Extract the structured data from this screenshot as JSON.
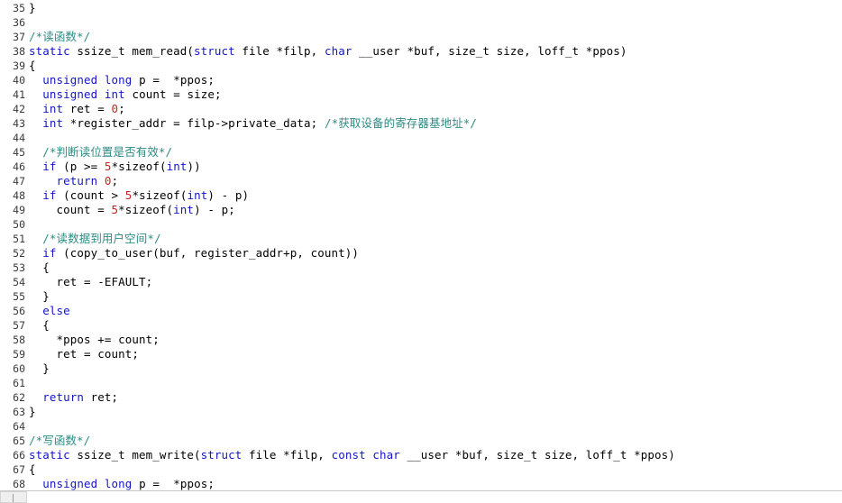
{
  "editor": {
    "language": "c",
    "first_line": 35,
    "last_line": 68,
    "colors": {
      "background": "#ffffff",
      "text": "#000000",
      "line_number": "#3a3a3a",
      "keyword": "#1414c8",
      "number": "#cc2222",
      "comment": "#2e8b84"
    }
  },
  "scrollbar": {
    "orientation": "horizontal",
    "thumb_label": ""
  },
  "lines": [
    {
      "n": "35",
      "tokens": [
        {
          "t": "}",
          "c": "txt"
        }
      ]
    },
    {
      "n": "36",
      "tokens": []
    },
    {
      "n": "37",
      "tokens": [
        {
          "t": "/*读函数*/",
          "c": "cmt"
        }
      ]
    },
    {
      "n": "38",
      "tokens": [
        {
          "t": "static",
          "c": "kw"
        },
        {
          "t": " ssize_t mem_read(",
          "c": "txt"
        },
        {
          "t": "struct",
          "c": "kw"
        },
        {
          "t": " file *filp, ",
          "c": "txt"
        },
        {
          "t": "char",
          "c": "kw"
        },
        {
          "t": " __user *buf, size_t size, loff_t *ppos)",
          "c": "txt"
        }
      ]
    },
    {
      "n": "39",
      "tokens": [
        {
          "t": "{",
          "c": "txt"
        }
      ]
    },
    {
      "n": "40",
      "tokens": [
        {
          "t": "  ",
          "c": "txt"
        },
        {
          "t": "unsigned",
          "c": "kw"
        },
        {
          "t": " ",
          "c": "txt"
        },
        {
          "t": "long",
          "c": "kw"
        },
        {
          "t": " p =  *ppos;",
          "c": "txt"
        }
      ]
    },
    {
      "n": "41",
      "tokens": [
        {
          "t": "  ",
          "c": "txt"
        },
        {
          "t": "unsigned",
          "c": "kw"
        },
        {
          "t": " ",
          "c": "txt"
        },
        {
          "t": "int",
          "c": "kw"
        },
        {
          "t": " count = size;",
          "c": "txt"
        }
      ]
    },
    {
      "n": "42",
      "tokens": [
        {
          "t": "  ",
          "c": "txt"
        },
        {
          "t": "int",
          "c": "kw"
        },
        {
          "t": " ret = ",
          "c": "txt"
        },
        {
          "t": "0",
          "c": "num"
        },
        {
          "t": ";",
          "c": "txt"
        }
      ]
    },
    {
      "n": "43",
      "tokens": [
        {
          "t": "  ",
          "c": "txt"
        },
        {
          "t": "int",
          "c": "kw"
        },
        {
          "t": " *register_addr = filp->private_data; ",
          "c": "txt"
        },
        {
          "t": "/*获取设备的寄存器基地址*/",
          "c": "cmt"
        }
      ]
    },
    {
      "n": "44",
      "tokens": []
    },
    {
      "n": "45",
      "tokens": [
        {
          "t": "  ",
          "c": "txt"
        },
        {
          "t": "/*判断读位置是否有效*/",
          "c": "cmt"
        }
      ]
    },
    {
      "n": "46",
      "tokens": [
        {
          "t": "  ",
          "c": "txt"
        },
        {
          "t": "if",
          "c": "kw"
        },
        {
          "t": " (p >= ",
          "c": "txt"
        },
        {
          "t": "5",
          "c": "num"
        },
        {
          "t": "*sizeof(",
          "c": "txt"
        },
        {
          "t": "int",
          "c": "kw"
        },
        {
          "t": "))",
          "c": "txt"
        }
      ]
    },
    {
      "n": "47",
      "tokens": [
        {
          "t": "    ",
          "c": "txt"
        },
        {
          "t": "return",
          "c": "kw"
        },
        {
          "t": " ",
          "c": "txt"
        },
        {
          "t": "0",
          "c": "num"
        },
        {
          "t": ";",
          "c": "txt"
        }
      ]
    },
    {
      "n": "48",
      "tokens": [
        {
          "t": "  ",
          "c": "txt"
        },
        {
          "t": "if",
          "c": "kw"
        },
        {
          "t": " (count > ",
          "c": "txt"
        },
        {
          "t": "5",
          "c": "num"
        },
        {
          "t": "*sizeof(",
          "c": "txt"
        },
        {
          "t": "int",
          "c": "kw"
        },
        {
          "t": ") - p)",
          "c": "txt"
        }
      ]
    },
    {
      "n": "49",
      "tokens": [
        {
          "t": "    count = ",
          "c": "txt"
        },
        {
          "t": "5",
          "c": "num"
        },
        {
          "t": "*sizeof(",
          "c": "txt"
        },
        {
          "t": "int",
          "c": "kw"
        },
        {
          "t": ") - p;",
          "c": "txt"
        }
      ]
    },
    {
      "n": "50",
      "tokens": []
    },
    {
      "n": "51",
      "tokens": [
        {
          "t": "  ",
          "c": "txt"
        },
        {
          "t": "/*读数据到用户空间*/",
          "c": "cmt"
        }
      ]
    },
    {
      "n": "52",
      "tokens": [
        {
          "t": "  ",
          "c": "txt"
        },
        {
          "t": "if",
          "c": "kw"
        },
        {
          "t": " (copy_to_user(buf, register_addr+p, count))",
          "c": "txt"
        }
      ]
    },
    {
      "n": "53",
      "tokens": [
        {
          "t": "  {",
          "c": "txt"
        }
      ]
    },
    {
      "n": "54",
      "tokens": [
        {
          "t": "    ret = -EFAULT;",
          "c": "txt"
        }
      ]
    },
    {
      "n": "55",
      "tokens": [
        {
          "t": "  }",
          "c": "txt"
        }
      ]
    },
    {
      "n": "56",
      "tokens": [
        {
          "t": "  ",
          "c": "txt"
        },
        {
          "t": "else",
          "c": "kw"
        }
      ]
    },
    {
      "n": "57",
      "tokens": [
        {
          "t": "  {",
          "c": "txt"
        }
      ]
    },
    {
      "n": "58",
      "tokens": [
        {
          "t": "    *ppos += count;",
          "c": "txt"
        }
      ]
    },
    {
      "n": "59",
      "tokens": [
        {
          "t": "    ret = count;",
          "c": "txt"
        }
      ]
    },
    {
      "n": "60",
      "tokens": [
        {
          "t": "  }",
          "c": "txt"
        }
      ]
    },
    {
      "n": "61",
      "tokens": []
    },
    {
      "n": "62",
      "tokens": [
        {
          "t": "  ",
          "c": "txt"
        },
        {
          "t": "return",
          "c": "kw"
        },
        {
          "t": " ret;",
          "c": "txt"
        }
      ]
    },
    {
      "n": "63",
      "tokens": [
        {
          "t": "}",
          "c": "txt"
        }
      ]
    },
    {
      "n": "64",
      "tokens": []
    },
    {
      "n": "65",
      "tokens": [
        {
          "t": "/*写函数*/",
          "c": "cmt"
        }
      ]
    },
    {
      "n": "66",
      "tokens": [
        {
          "t": "static",
          "c": "kw"
        },
        {
          "t": " ssize_t mem_write(",
          "c": "txt"
        },
        {
          "t": "struct",
          "c": "kw"
        },
        {
          "t": " file *filp, ",
          "c": "txt"
        },
        {
          "t": "const",
          "c": "kw"
        },
        {
          "t": " ",
          "c": "txt"
        },
        {
          "t": "char",
          "c": "kw"
        },
        {
          "t": " __user *buf, size_t size, loff_t *ppos)",
          "c": "txt"
        }
      ]
    },
    {
      "n": "67",
      "tokens": [
        {
          "t": "{",
          "c": "txt"
        }
      ]
    },
    {
      "n": "68",
      "tokens": [
        {
          "t": "  ",
          "c": "txt"
        },
        {
          "t": "unsigned",
          "c": "kw"
        },
        {
          "t": " ",
          "c": "txt"
        },
        {
          "t": "long",
          "c": "kw"
        },
        {
          "t": " p =  *ppos;",
          "c": "txt"
        }
      ]
    }
  ]
}
